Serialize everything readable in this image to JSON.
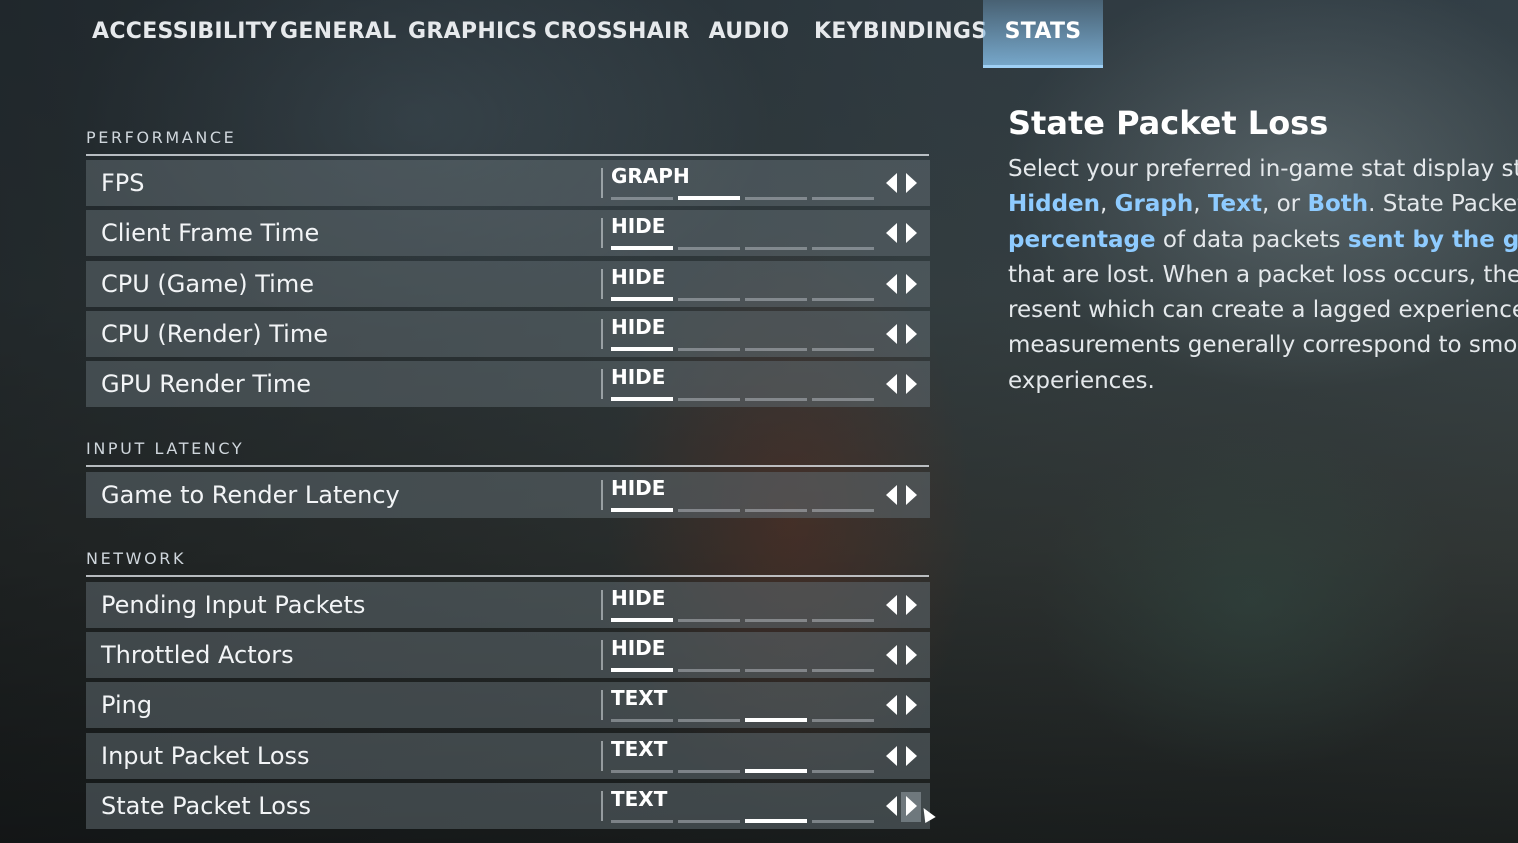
{
  "tabs": [
    {
      "label": "ACCESSIBILITY"
    },
    {
      "label": "GENERAL"
    },
    {
      "label": "GRAPHICS"
    },
    {
      "label": "CROSSHAIR"
    },
    {
      "label": "AUDIO"
    },
    {
      "label": "KEYBINDINGS"
    },
    {
      "label": "STATS",
      "active": true
    }
  ],
  "sections": [
    {
      "title": "PERFORMANCE"
    },
    {
      "title": "INPUT LATENCY"
    },
    {
      "title": "NETWORK"
    }
  ],
  "rows": [
    {
      "label": "FPS",
      "value": "GRAPH",
      "level_index": 1
    },
    {
      "label": "Client Frame Time",
      "value": "HIDE",
      "level_index": 0
    },
    {
      "label": "CPU (Game) Time",
      "value": "HIDE",
      "level_index": 0
    },
    {
      "label": "CPU (Render) Time",
      "value": "HIDE",
      "level_index": 0
    },
    {
      "label": "GPU Render Time",
      "value": "HIDE",
      "level_index": 0
    },
    {
      "label": "Game to Render Latency",
      "value": "HIDE",
      "level_index": 0
    },
    {
      "label": "Pending Input Packets",
      "value": "HIDE",
      "level_index": 0
    },
    {
      "label": "Throttled Actors",
      "value": "HIDE",
      "level_index": 0
    },
    {
      "label": "Ping",
      "value": "TEXT",
      "level_index": 2
    },
    {
      "label": "Input Packet Loss",
      "value": "TEXT",
      "level_index": 2
    },
    {
      "label": "State Packet Loss",
      "value": "TEXT",
      "level_index": 2
    }
  ],
  "option_count": 4,
  "detail": {
    "title": "State Packet Loss",
    "p1": "Select your preferred in-game stat display style from ",
    "opt1": "Hidden",
    "c1": ", ",
    "opt2": "Graph",
    "c2": ", ",
    "opt3": "Text",
    "c3": ", or ",
    "opt4": "Both",
    "p2": ". State Packet Loss is the ",
    "hl1": "percentage",
    "p3": " of data packets ",
    "hl2": "sent by the game server",
    "p4": " that are lost. When a packet loss occurs, the packet must be resent which can create a lagged experience. Lower measurements generally correspond to smoother experiences."
  },
  "colors": {
    "accent": "#8ecbff",
    "active_tab": "#82b9e1"
  }
}
